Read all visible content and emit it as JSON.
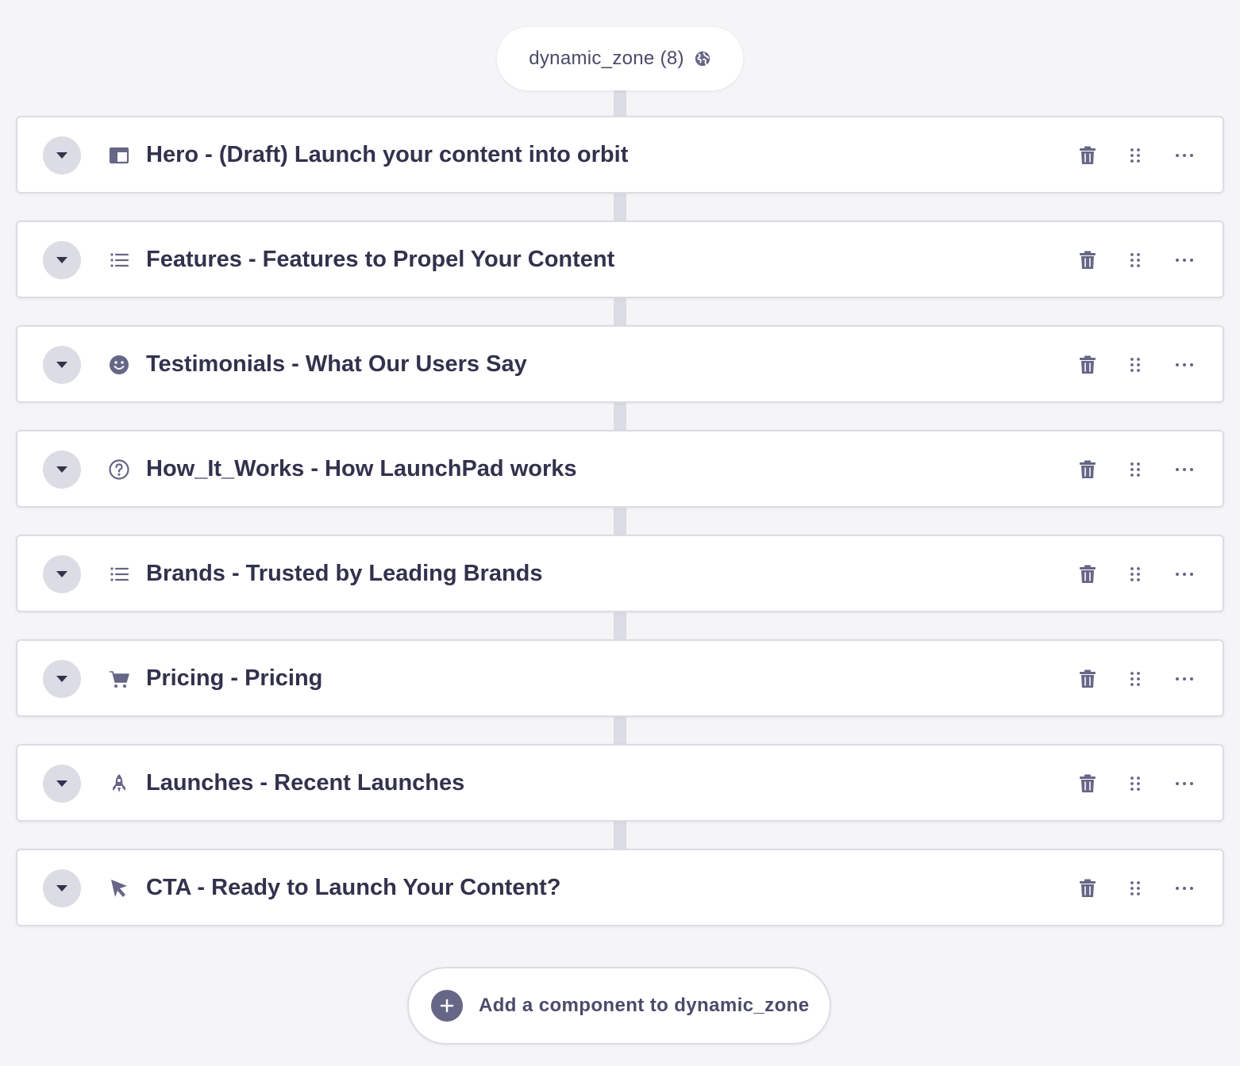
{
  "zone": {
    "label": "dynamic_zone (8)",
    "icon": "globe-icon"
  },
  "components": [
    {
      "title": "Hero - (Draft) Launch your content into orbit",
      "icon": "layout-icon"
    },
    {
      "title": "Features - Features to Propel Your Content",
      "icon": "list-icon"
    },
    {
      "title": "Testimonials - What Our Users Say",
      "icon": "smile-icon"
    },
    {
      "title": "How_It_Works - How LaunchPad works",
      "icon": "question-icon"
    },
    {
      "title": "Brands - Trusted by Leading Brands",
      "icon": "list-icon"
    },
    {
      "title": "Pricing - Pricing",
      "icon": "cart-icon"
    },
    {
      "title": "Launches - Recent Launches",
      "icon": "rocket-icon"
    },
    {
      "title": "CTA - Ready to Launch Your Content?",
      "icon": "cursor-icon"
    }
  ],
  "row_actions": [
    "trash-icon",
    "drag-handle-icon",
    "more-icon"
  ],
  "add_button": {
    "label": "Add a component to dynamic_zone",
    "icon": "plus-icon"
  },
  "colors": {
    "background": "#f5f5f7",
    "icon": "#666687",
    "text": "#32324d",
    "border": "#dcdce4"
  }
}
